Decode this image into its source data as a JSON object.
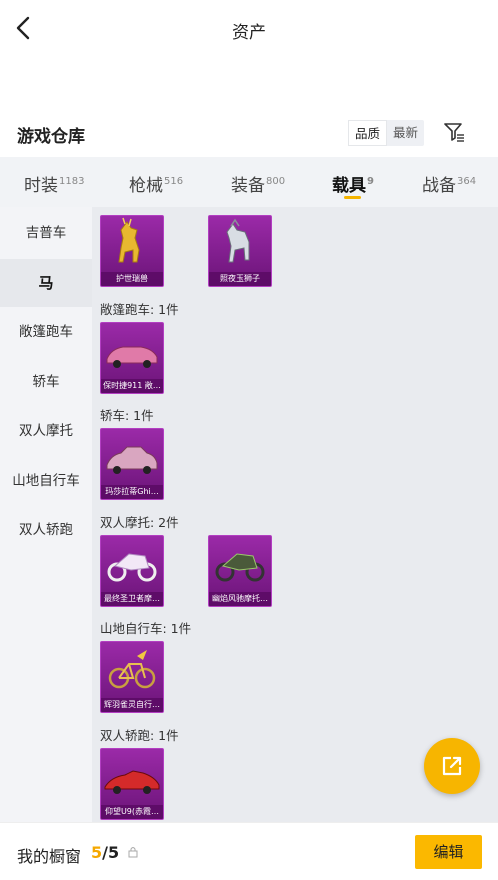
{
  "header": {
    "title": "资产"
  },
  "warehouse": {
    "title": "游戏仓库",
    "sort_options": [
      "品质",
      "最新"
    ]
  },
  "tabs": [
    {
      "label": "时装",
      "count": "1183"
    },
    {
      "label": "枪械",
      "count": "516"
    },
    {
      "label": "装备",
      "count": "800"
    },
    {
      "label": "载具",
      "count": "9"
    },
    {
      "label": "战备",
      "count": "364"
    }
  ],
  "sidebar": {
    "items": [
      {
        "label": "吉普车"
      },
      {
        "label": "马"
      },
      {
        "label": "敞篷跑车"
      },
      {
        "label": "轿车"
      },
      {
        "label": "双人摩托"
      },
      {
        "label": "山地自行车"
      },
      {
        "label": "双人轿跑"
      }
    ]
  },
  "sections": [
    {
      "label": "",
      "items": [
        {
          "name": "护世瑞兽",
          "icon": "golden-horse"
        },
        {
          "name": "照夜玉狮子",
          "icon": "silver-horse"
        }
      ]
    },
    {
      "label": "敞篷跑车: 1件",
      "items": [
        {
          "name": "保时捷911 敞…",
          "icon": "pink-convertible"
        }
      ]
    },
    {
      "label": "轿车: 1件",
      "items": [
        {
          "name": "玛莎拉蒂Ghi…",
          "icon": "pink-sedan"
        }
      ]
    },
    {
      "label": "双人摩托: 2件",
      "items": [
        {
          "name": "最终圣卫者摩…",
          "icon": "white-motorcycle"
        },
        {
          "name": "幽焰风驰摩托…",
          "icon": "green-motorcycle"
        }
      ]
    },
    {
      "label": "山地自行车: 1件",
      "items": [
        {
          "name": "辉羽雀灵自行…",
          "icon": "golden-bicycle"
        }
      ]
    },
    {
      "label": "双人轿跑: 1件",
      "items": [
        {
          "name": "仰望U9(赤霞…",
          "icon": "red-supercar"
        }
      ]
    }
  ],
  "footer": {
    "showcase_label": "我的橱窗",
    "showcase_current": "5",
    "showcase_total": "/5",
    "edit_label": "编辑"
  },
  "colors": {
    "accent": "#f5b400",
    "card": "#8e1f9c"
  }
}
